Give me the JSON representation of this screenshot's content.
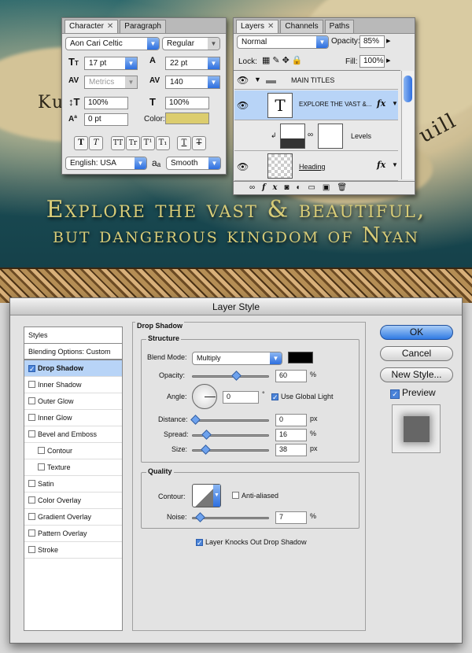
{
  "map": {
    "left_text": "Ku",
    "right_text": "uill"
  },
  "banner": {
    "line1": "Explore the vast & beautiful,",
    "line2": "but dangerous kingdom of Nyan"
  },
  "character": {
    "tabs": [
      "Character",
      "Paragraph"
    ],
    "font_family": "Aon Cari Celtic",
    "font_style": "Regular",
    "size": "17 pt",
    "leading": "22 pt",
    "kerning": "Metrics",
    "tracking": "140",
    "vscale": "100%",
    "hscale": "100%",
    "baseline": "0 pt",
    "color_label": "Color:",
    "color": "#dccd6e",
    "style_buttons": [
      "T",
      "T",
      "TT",
      "Tr",
      "T¹",
      "T₁",
      "T",
      "T"
    ],
    "language": "English: USA",
    "aa_icon": "aₐ",
    "aa": "Smooth"
  },
  "layers": {
    "tabs": [
      "Layers",
      "Channels",
      "Paths"
    ],
    "blend": "Normal",
    "opacity_label": "Opacity:",
    "opacity": "85%",
    "lock_label": "Lock:",
    "fill_label": "Fill:",
    "fill": "100%",
    "rows": [
      {
        "name": "MAIN TITLES",
        "kind": "group"
      },
      {
        "name": "EXPLORE THE VAST &...",
        "kind": "text",
        "fx": "fx"
      },
      {
        "name": "Levels",
        "kind": "adjust"
      },
      {
        "name": "Heading",
        "kind": "layer",
        "fx": "fx"
      }
    ]
  },
  "dialog": {
    "title": "Layer Style",
    "styles_header": "Styles",
    "blending": "Blending Options: Custom",
    "items": [
      {
        "label": "Drop Shadow",
        "checked": true,
        "selected": true
      },
      {
        "label": "Inner Shadow",
        "checked": false
      },
      {
        "label": "Outer Glow",
        "checked": false
      },
      {
        "label": "Inner Glow",
        "checked": false
      },
      {
        "label": "Bevel and Emboss",
        "checked": false
      },
      {
        "label": "Contour",
        "checked": false,
        "indent": true
      },
      {
        "label": "Texture",
        "checked": false,
        "indent": true
      },
      {
        "label": "Satin",
        "checked": false
      },
      {
        "label": "Color Overlay",
        "checked": false
      },
      {
        "label": "Gradient Overlay",
        "checked": false
      },
      {
        "label": "Pattern Overlay",
        "checked": false
      },
      {
        "label": "Stroke",
        "checked": false
      }
    ],
    "section": "Drop Shadow",
    "structure": "Structure",
    "blend_label": "Blend Mode:",
    "blend_value": "Multiply",
    "shadow_color": "#000000",
    "opacity_label": "Opacity:",
    "opacity": "60",
    "opacity_level": 0.6,
    "angle_label": "Angle:",
    "angle": "0",
    "global_light": "Use Global Light",
    "distance_label": "Distance:",
    "distance": "0",
    "distance_level": 0,
    "spread_label": "Spread:",
    "spread": "16",
    "spread_level": 0.16,
    "size_label": "Size:",
    "size": "38",
    "size_level": 0.15,
    "pct": "%",
    "px": "px",
    "deg": "°",
    "quality": "Quality",
    "contour_label": "Contour:",
    "anti_aliased": "Anti-aliased",
    "noise_label": "Noise:",
    "noise": "7",
    "noise_level": 0.07,
    "knockout": "Layer Knocks Out Drop Shadow",
    "ok": "OK",
    "cancel": "Cancel",
    "new_style": "New Style...",
    "preview": "Preview"
  }
}
